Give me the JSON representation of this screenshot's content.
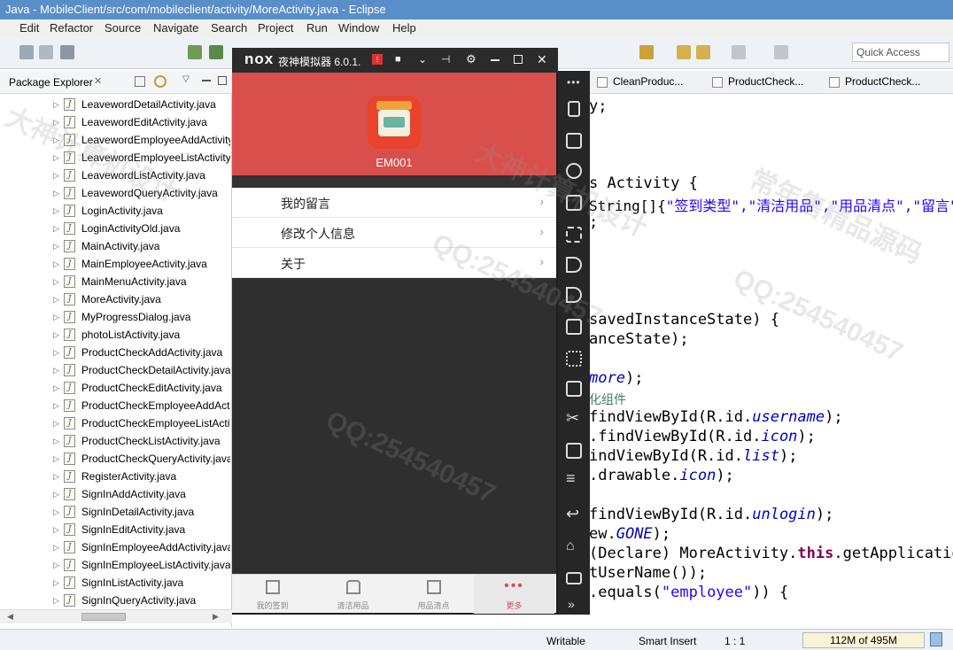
{
  "window": {
    "title": "Java - MobileClient/src/com/mobileclient/activity/MoreActivity.java - Eclipse"
  },
  "menu": [
    "Edit",
    "Refactor",
    "Source",
    "Navigate",
    "Search",
    "Project",
    "Run",
    "Window",
    "Help"
  ],
  "toolbar": {
    "quick_access_placeholder": "Quick Access"
  },
  "package_explorer": {
    "title": "Package Explorer",
    "close_glyph": "✕",
    "files": [
      "LeavewordDetailActivity.java",
      "LeavewordEditActivity.java",
      "LeavewordEmployeeAddActivity.java",
      "LeavewordEmployeeListActivity.java",
      "LeavewordListActivity.java",
      "LeavewordQueryActivity.java",
      "LoginActivity.java",
      "LoginActivityOld.java",
      "MainActivity.java",
      "MainEmployeeActivity.java",
      "MainMenuActivity.java",
      "MoreActivity.java",
      "MyProgressDialog.java",
      "photoListActivity.java",
      "ProductCheckAddActivity.java",
      "ProductCheckDetailActivity.java",
      "ProductCheckEditActivity.java",
      "ProductCheckEmployeeAddActivity.java",
      "ProductCheckEmployeeListActivity.java",
      "ProductCheckListActivity.java",
      "ProductCheckQueryActivity.java",
      "RegisterActivity.java",
      "SignInAddActivity.java",
      "SignInDetailActivity.java",
      "SignInEditActivity.java",
      "SignInEmployeeAddActivity.java",
      "SignInEmployeeListActivity.java",
      "SignInListActivity.java",
      "SignInQueryActivity.java"
    ]
  },
  "editor": {
    "tabs": [
      "CleanProduc...",
      "ProductCheck...",
      "ProductCheck..."
    ],
    "lines": {
      "l1": "y;",
      "l2a": "s Activity {",
      "l3a": "String[]{",
      "l3b": "\"签到类型\",\"清洁用品\",\"用品清点\",\"留言\"",
      "l4": ";",
      "l5": "savedInstanceState) {",
      "l6": "anceState);",
      "l7a": "more",
      "l7b": ");",
      "l8": "化组件",
      "l9a": "findViewById(R.id.",
      "l9b": "username",
      "l9c": ");",
      "l10a": ".findViewById(R.id.",
      "l10b": "icon",
      "l10c": ");",
      "l11a": "indViewById(R.id.",
      "l11b": "list",
      "l11c": ");",
      "l12a": ".drawable.",
      "l12b": "icon",
      "l12c": ");",
      "l13a": "findViewById(R.id.",
      "l13b": "unlogin",
      "l13c": ");",
      "l14a": "ew.",
      "l14b": "GONE",
      "l14c": ");",
      "l15a": "(Declare) MoreActivity.",
      "l15b": "this",
      "l15c": ".getApplicatio",
      "l16": "tUserName());",
      "l17a": ".equals(",
      "l17b": "\"employee\"",
      "l17c": ")) {"
    }
  },
  "status": {
    "writable": "Writable",
    "insert_mode": "Smart Insert",
    "position": "1 : 1",
    "heap": "112M of 495M"
  },
  "emulator": {
    "title": "夜神模拟器 6.0.1.",
    "brand": "nox",
    "username": "EM001",
    "menu_items": [
      "我的留言",
      "修改个人信息",
      "关于"
    ],
    "nav": [
      {
        "label": "我的签到"
      },
      {
        "label": "清洁用品"
      },
      {
        "label": "用品清点"
      },
      {
        "label": "更多"
      }
    ],
    "accent": "#d94f4c"
  },
  "watermarks": [
    "QQ:254540457",
    "大神计算机设计",
    "常年售精品源码"
  ]
}
